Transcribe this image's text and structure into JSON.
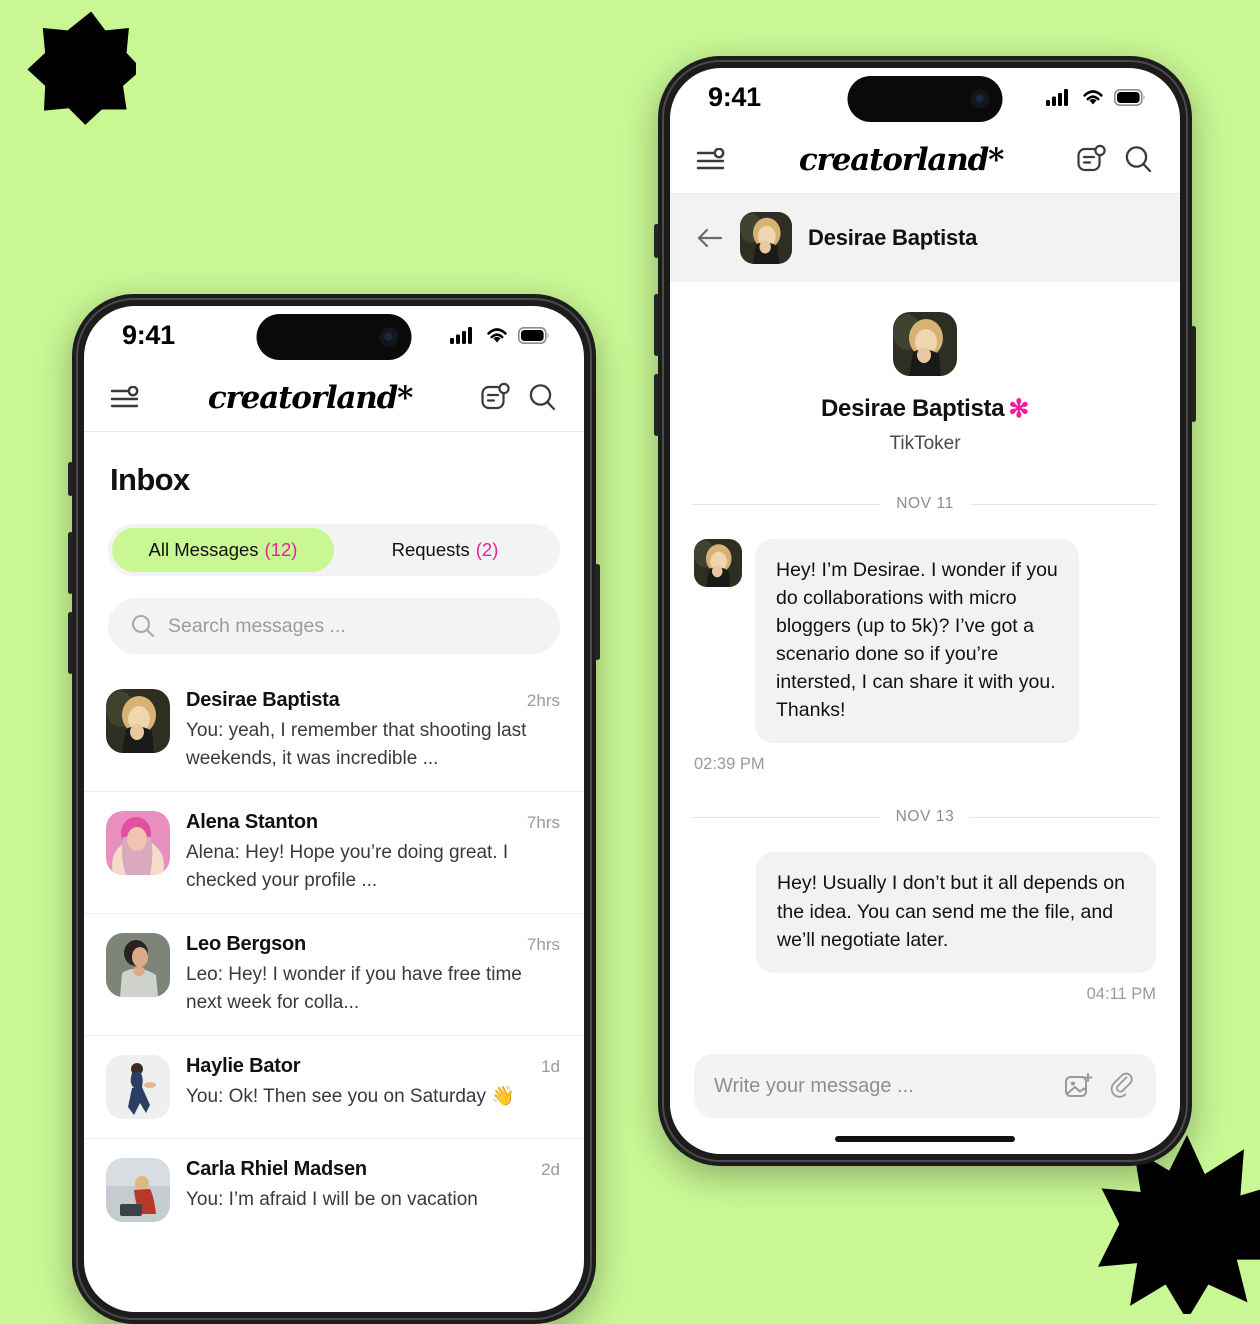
{
  "theme": {
    "background": "#C9F794",
    "accent_green": "#C9F794",
    "accent_magenta": "#E6219B",
    "verified_magenta": "#F020A0",
    "surface_gray": "#F2F2F2"
  },
  "status_bar": {
    "time": "9:41"
  },
  "app": {
    "brand": "creatorland*",
    "icons": {
      "menu": "menu-filter-icon",
      "notes": "notes-notification-icon",
      "search": "search-icon"
    }
  },
  "inbox": {
    "title": "Inbox",
    "tabs": [
      {
        "label": "All Messages",
        "count": "(12)",
        "active": true
      },
      {
        "label": "Requests",
        "count": "(2)",
        "active": false
      }
    ],
    "search": {
      "placeholder": "Search messages ...",
      "value": ""
    },
    "messages": [
      {
        "name": "Desirae Baptista",
        "time": "2hrs",
        "preview": "You: yeah, I remember that shooting last weekends, it was incredible ...",
        "avatar": "desirae"
      },
      {
        "name": "Alena Stanton",
        "time": "7hrs",
        "preview": "Alena: Hey! Hope you’re doing great. I checked your profile ...",
        "avatar": "alena"
      },
      {
        "name": "Leo Bergson",
        "time": "7hrs",
        "preview": "Leo: Hey! I wonder if you have free time next week for colla...",
        "avatar": "leo"
      },
      {
        "name": "Haylie Bator",
        "time": "1d",
        "preview": "You: Ok! Then see you on Saturday 👋",
        "avatar": "haylie"
      },
      {
        "name": "Carla Rhiel Madsen",
        "time": "2d",
        "preview": "You: I’m afraid I will be on vacation",
        "avatar": "carla"
      }
    ]
  },
  "conversation": {
    "header_name": "Desirae Baptista",
    "back_icon": "back-arrow-icon",
    "profile": {
      "name": "Desirae Baptista",
      "verified_badge": "✻",
      "role": "TikToker"
    },
    "threads": [
      {
        "date": "NOV 11",
        "text": "Hey! I’m Desirae. I wonder if you do collaborations with micro bloggers (up to 5k)? I’ve got a scenario done so if you’re intersted, I can share it with you. Thanks!",
        "time": "02:39 PM",
        "side": "left"
      },
      {
        "date": "NOV 13",
        "text": "Hey! Usually I don’t but it all depends on the idea. You can send me the file, and we’ll negotiate later.",
        "time": "04:11 PM",
        "side": "right"
      }
    ],
    "composer": {
      "placeholder": "Write your message ...",
      "value": "",
      "icons": {
        "image": "add-image-icon",
        "attach": "paperclip-icon"
      }
    }
  }
}
